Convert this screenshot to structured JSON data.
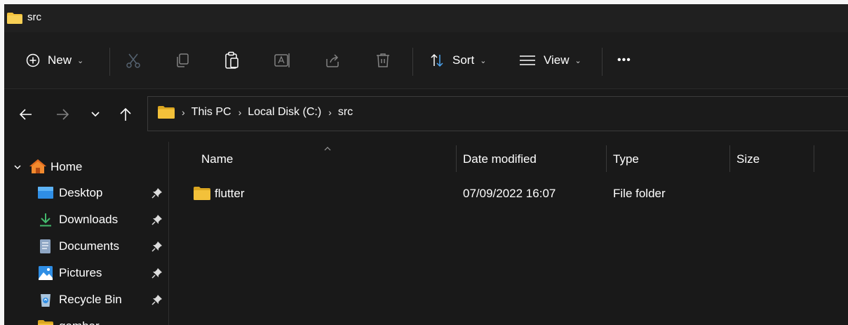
{
  "window": {
    "title": "src"
  },
  "toolbar": {
    "new_label": "New",
    "sort_label": "Sort",
    "view_label": "View",
    "more_label": "•••",
    "icons": [
      "cut-icon",
      "copy-icon",
      "paste-icon",
      "rename-icon",
      "share-icon",
      "delete-icon"
    ]
  },
  "breadcrumb": {
    "segments": [
      "This PC",
      "Local Disk (C:)",
      "src"
    ],
    "separator": "›"
  },
  "sidebar": {
    "home_label": "Home",
    "items": [
      {
        "label": "Desktop",
        "icon": "desktop-icon",
        "pinned": true
      },
      {
        "label": "Downloads",
        "icon": "download-icon",
        "pinned": true
      },
      {
        "label": "Documents",
        "icon": "document-icon",
        "pinned": true
      },
      {
        "label": "Pictures",
        "icon": "pictures-icon",
        "pinned": true
      },
      {
        "label": "Recycle Bin",
        "icon": "recycle-bin-icon",
        "pinned": true
      },
      {
        "label": "gambar",
        "icon": "folder-icon",
        "pinned": false
      }
    ]
  },
  "columns": {
    "name": "Name",
    "date_modified": "Date modified",
    "type": "Type",
    "size": "Size"
  },
  "files": [
    {
      "name": "flutter",
      "date_modified": "07/09/2022 16:07",
      "type": "File folder",
      "size": ""
    }
  ],
  "colors": {
    "folder": "#f3c13a",
    "folder_dark": "#d9a520",
    "background": "#191919",
    "accent": "#4ca4f0"
  }
}
